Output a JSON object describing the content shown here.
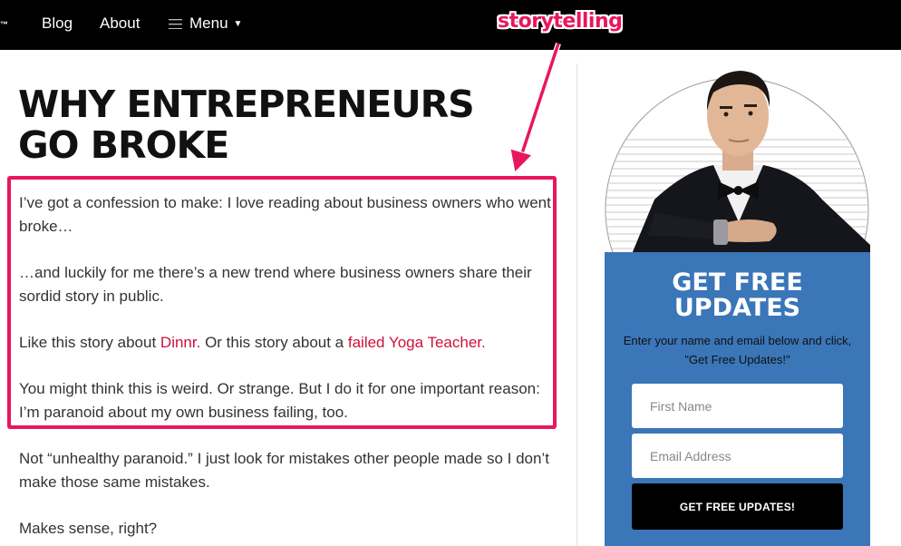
{
  "nav": {
    "brand_mark": "™",
    "links": [
      "Blog",
      "About"
    ],
    "menu_label": "Menu",
    "background": "#000000"
  },
  "annotation": {
    "label": "storytelling",
    "color": "#e8175d"
  },
  "article": {
    "title": "WHY ENTREPRENEURS GO BROKE",
    "paragraphs": [
      {
        "text": "I’ve got a confession to make: I love reading about business owners who went broke…"
      },
      {
        "text": "…and luckily for me there’s a new trend where business owners share their sordid story in public."
      },
      {
        "before": "Like this story about ",
        "link1": "Dinnr.",
        "middle": " Or this story about a ",
        "link2": "failed Yoga Teacher."
      },
      {
        "text": "You might think this is weird. Or strange. But I do it for one important reason: I’m paranoid about my own business failing, too."
      },
      {
        "text": "Not “unhealthy paranoid.” I just look for mistakes other people made so I don’t make those same mistakes."
      },
      {
        "text": "Makes sense, right?"
      }
    ],
    "link_color": "#d0103a"
  },
  "sidebar": {
    "optin": {
      "title": "GET FREE UPDATES",
      "subtitle": "Enter your name and email below and click, \"Get Free Updates!\"",
      "first_name_placeholder": "First Name",
      "email_placeholder": "Email Address",
      "submit_label": "GET FREE UPDATES!",
      "background": "#3a76b8"
    }
  }
}
